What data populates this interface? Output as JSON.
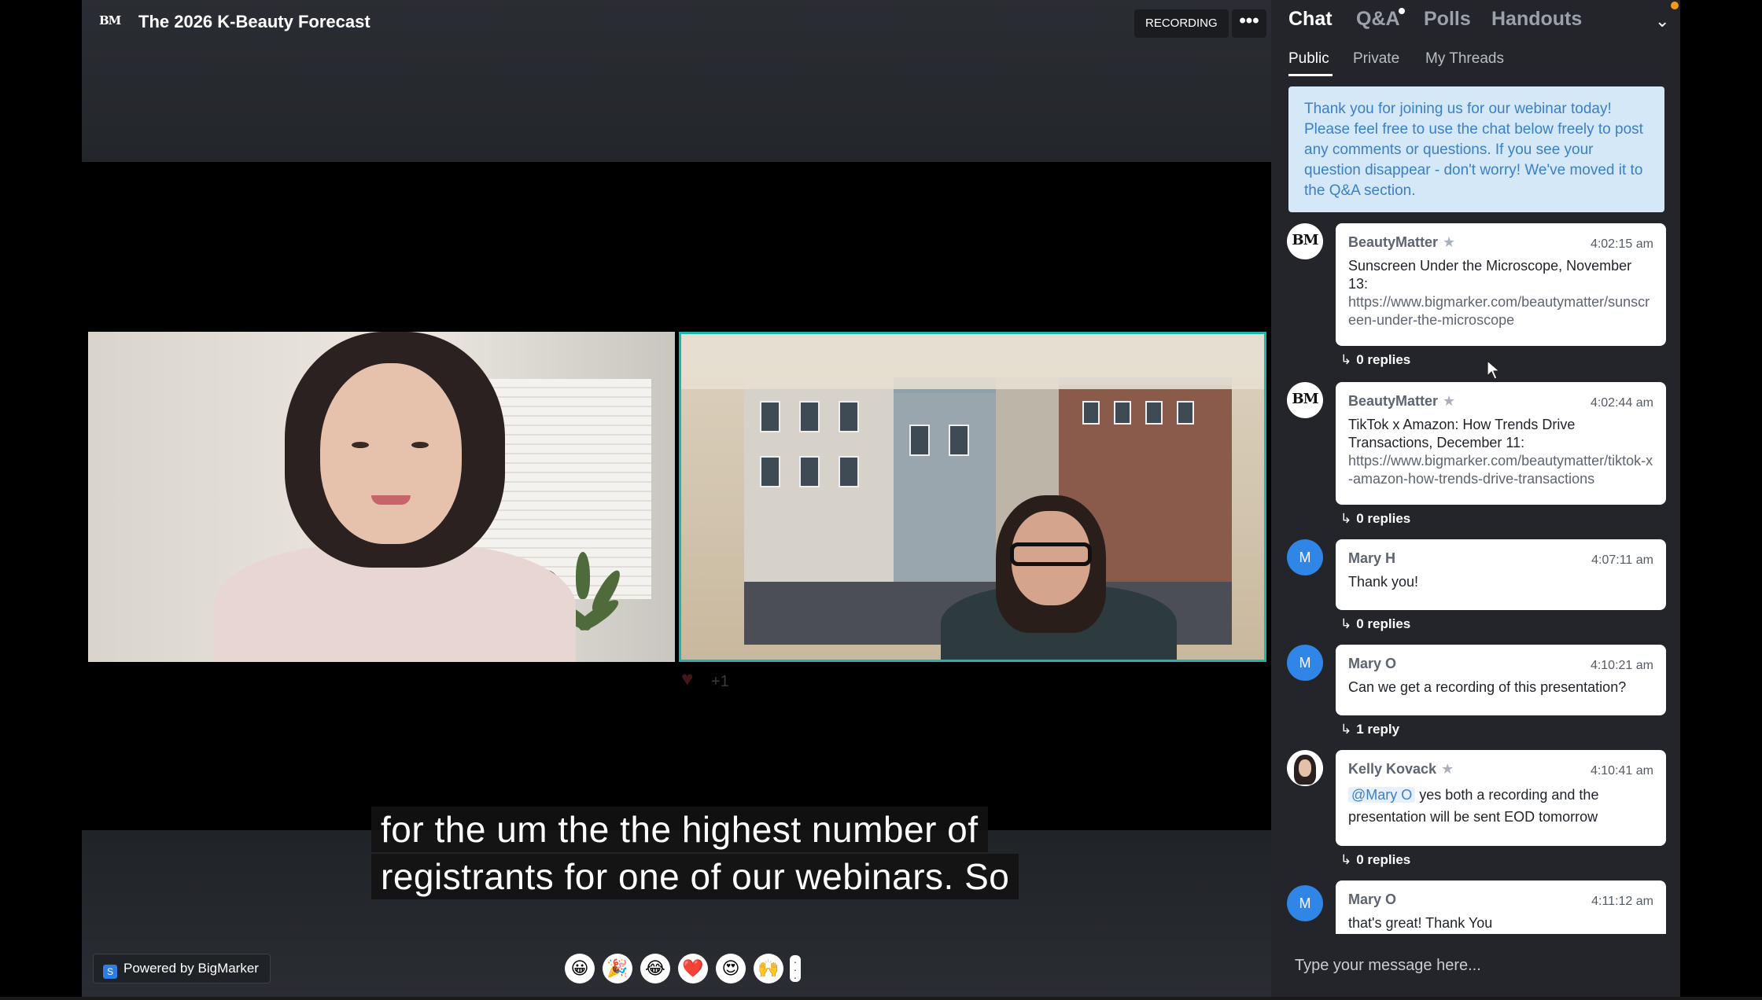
{
  "header": {
    "logo_text": "BM",
    "title": "The 2026 K-Beauty Forecast",
    "recording_label": "RECORDING",
    "more_label": "•••"
  },
  "stage": {
    "reaction_heart": "♥",
    "reaction_count": "+1",
    "caption_lines": [
      "for the um the the highest number of",
      "registrants for one of our webinars. So"
    ],
    "powered_by_label": "Powered by BigMarker",
    "emoji_reactions": [
      "😀",
      "🎉",
      "😂",
      "❤️",
      "😍",
      "🙌"
    ]
  },
  "sidebar": {
    "tabs": [
      {
        "label": "Chat",
        "active": true
      },
      {
        "label": "Q&A",
        "active": false,
        "has_dot": true
      },
      {
        "label": "Polls",
        "active": false
      },
      {
        "label": "Handouts",
        "active": false
      }
    ],
    "subtabs": [
      {
        "label": "Public",
        "active": true
      },
      {
        "label": "Private",
        "active": false
      },
      {
        "label": "My Threads",
        "active": false
      }
    ],
    "welcome_message": "Thank you for joining us for our webinar today! Please feel free to use the chat below freely to post any comments or questions. If you see your question disappear - don't worry! We've moved it to the Q&A section.",
    "messages": [
      {
        "avatar": "BM",
        "sender": "BeautyMatter",
        "starred": true,
        "time": "4:02:15 am",
        "text": "Sunscreen Under the Microscope, November 13:",
        "link": "https://www.bigmarker.com/beautymatter/sunscreen-under-the-microscope",
        "replies": "0 replies"
      },
      {
        "avatar": "BM",
        "sender": "BeautyMatter",
        "starred": true,
        "time": "4:02:44 am",
        "text": "TikTok x Amazon: How Trends Drive Transactions, December 11:",
        "link": "https://www.bigmarker.com/beautymatter/tiktok-x-amazon-how-trends-drive-transactions",
        "replies": "0 replies"
      },
      {
        "avatar": "M",
        "sender": "Mary H",
        "starred": false,
        "time": "4:07:11 am",
        "text": "Thank you!",
        "replies": "0 replies"
      },
      {
        "avatar": "M",
        "sender": "Mary O",
        "starred": false,
        "time": "4:10:21 am",
        "text": "Can we get a recording of this presentation?",
        "replies": "1 reply"
      },
      {
        "avatar": "photo",
        "sender": "Kelly Kovack",
        "starred": true,
        "time": "4:10:41 am",
        "mention": "@Mary O",
        "text": "yes both a recording and the presentation will be sent EOD tomorrow",
        "replies": "0 replies"
      },
      {
        "avatar": "M",
        "sender": "Mary O",
        "starred": false,
        "time": "4:11:12 am",
        "text": "that's great! Thank You"
      }
    ],
    "input_placeholder": "Type your message here...",
    "star_glyph": "★",
    "reply_arrow": "↳"
  },
  "colors": {
    "accent_teal": "#1fb6a9",
    "avatar_blue": "#2f86e6",
    "notify_orange": "#f39a1e",
    "welcome_bg": "#d5e8f8",
    "welcome_text": "#3b7fc4"
  }
}
